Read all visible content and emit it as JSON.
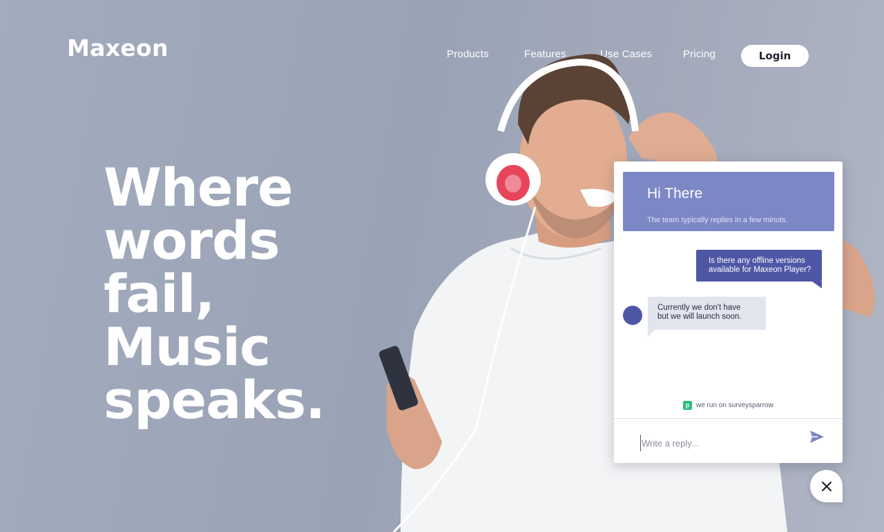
{
  "brand": {
    "name": "Maxeon"
  },
  "nav": {
    "items": [
      {
        "label": "Products"
      },
      {
        "label": "Features"
      },
      {
        "label": "Use Cases"
      },
      {
        "label": "Pricing"
      }
    ],
    "login_label": "Login"
  },
  "hero": {
    "lines": [
      "Where",
      "words",
      "fail,",
      "Music",
      "speaks."
    ]
  },
  "chat": {
    "title": "Hi There",
    "subtitle": "The team typically replies in a few minuts.",
    "messages": [
      {
        "from": "user",
        "lines": [
          "Is there any offline versions",
          "available for Maxeon Player?"
        ]
      },
      {
        "from": "agent",
        "lines": [
          "Currently we don't have",
          "but we will launch soon."
        ]
      }
    ],
    "powered_by": "we run on surveysparrow",
    "powered_icon_letter": "p",
    "reply_placeholder": "Write a reply...",
    "send_icon": "send-icon",
    "close_icon": "close-icon"
  },
  "colors": {
    "background": "#9ea6b9",
    "chat_header": "#7c87c6",
    "chat_primary": "#4e57a5",
    "agent_bubble": "#e2e5ee",
    "powered_icon": "#2dbd7e"
  }
}
